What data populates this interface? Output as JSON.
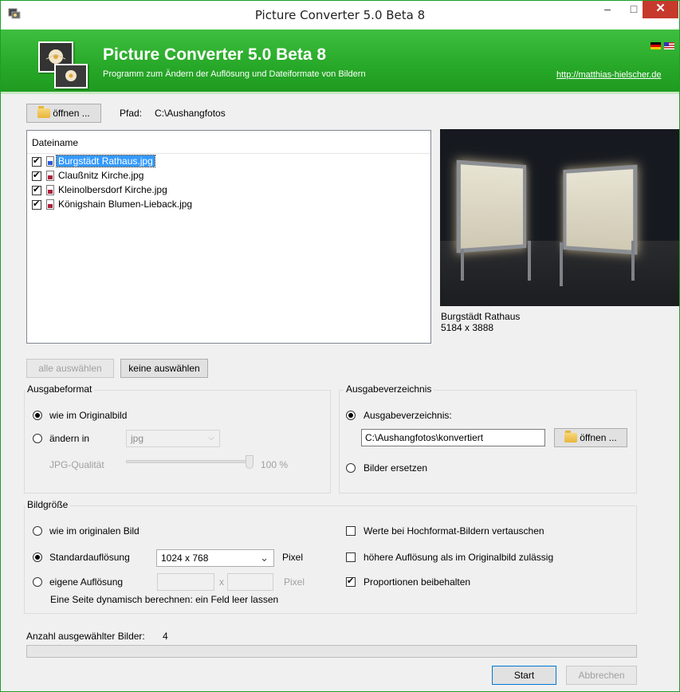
{
  "window": {
    "title": "Picture Converter 5.0 Beta 8",
    "minimize_glyph": "–",
    "maximize_glyph": "□",
    "close_glyph": "✕"
  },
  "header": {
    "title": "Picture Converter 5.0 Beta 8",
    "subtitle": "Programm zum Ändern der Auflösung und Dateiformate von Bildern",
    "link": "http://matthias-hielscher.de",
    "flags": [
      "de",
      "us"
    ]
  },
  "toolbar": {
    "open_label": "öffnen ...",
    "path_label": "Pfad:",
    "path_value": "C:\\Aushangfotos"
  },
  "file_list": {
    "column_header": "Dateiname",
    "files": [
      {
        "name": "Burgstädt Rathaus.jpg",
        "checked": true,
        "selected": true
      },
      {
        "name": "Claußnitz Kirche.jpg",
        "checked": true,
        "selected": false
      },
      {
        "name": "Kleinolbersdorf Kirche.jpg",
        "checked": true,
        "selected": false
      },
      {
        "name": "Königshain Blumen-Lieback.jpg",
        "checked": true,
        "selected": false
      }
    ]
  },
  "preview": {
    "name": "Burgstädt Rathaus",
    "dimensions": "5184 x 3888"
  },
  "selection_buttons": {
    "select_all": "alle auswählen",
    "select_none": "keine auswählen"
  },
  "output_format": {
    "title": "Ausgabeformat",
    "as_original": "wie im Originalbild",
    "change_to": "ändern in",
    "format_value": "jpg",
    "jpg_quality_label": "JPG-Qualität",
    "jpg_quality_value": "100 %",
    "jpg_quality": 100,
    "selected": "as_original"
  },
  "output_dir": {
    "title": "Ausgabeverzeichnis",
    "option_dir": "Ausgabeverzeichnis:",
    "dir_value": "C:\\Aushangfotos\\konvertiert",
    "open_label": "öffnen ...",
    "option_replace": "Bilder ersetzen",
    "selected": "dir"
  },
  "image_size": {
    "title": "Bildgröße",
    "as_original": "wie im originalen Bild",
    "standard": "Standardauflösung",
    "standard_value": "1024 x 768",
    "pixel_label": "Pixel",
    "custom": "eigene Auflösung",
    "x_label": "x",
    "custom_width": "",
    "custom_height": "",
    "hint": "Eine Seite dynamisch berechnen: ein Feld leer lassen",
    "selected": "standard",
    "swap_portrait": "Werte bei Hochformat-Bildern vertauschen",
    "swap_portrait_checked": false,
    "allow_upscale": "höhere Auflösung als im Originalbild zulässig",
    "allow_upscale_checked": false,
    "keep_ratio": "Proportionen beibehalten",
    "keep_ratio_checked": true
  },
  "status": {
    "count_label": "Anzahl ausgewählter Bilder:",
    "count_value": "4",
    "progress": 0
  },
  "actions": {
    "start": "Start",
    "cancel": "Abbrechen"
  }
}
